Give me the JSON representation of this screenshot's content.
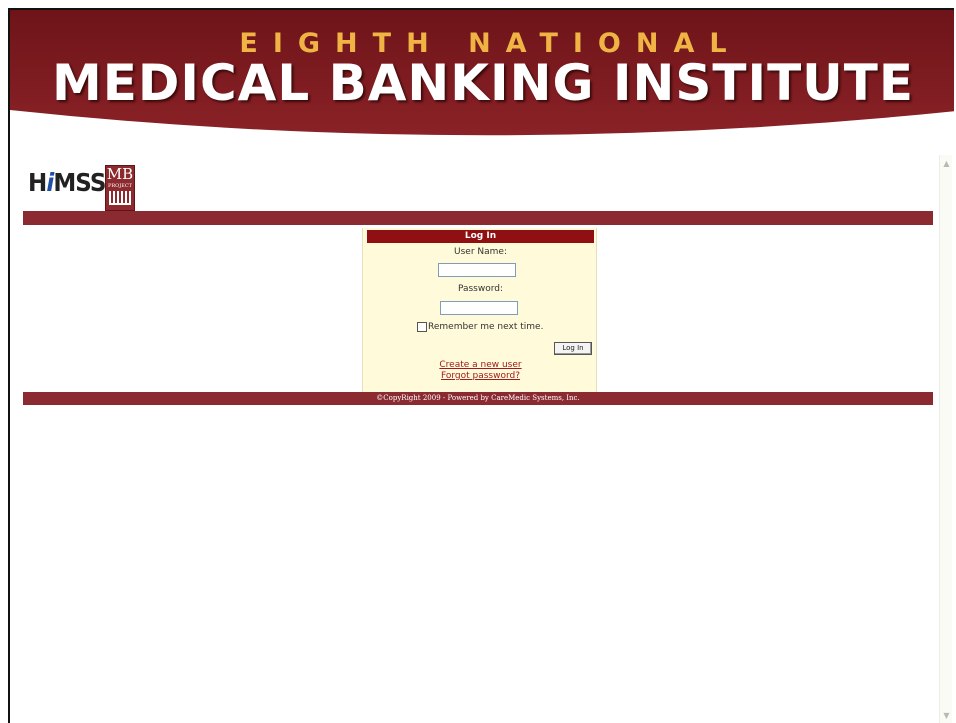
{
  "banner": {
    "line1": "EIGHTH NATIONAL",
    "line2": "MEDICAL BANKING INSTITUTE"
  },
  "logos": {
    "himss": {
      "prefix": "H",
      "accent": "i",
      "suffix": "MSS"
    },
    "mb": {
      "title": "MB",
      "sub": "PROJECT"
    }
  },
  "login": {
    "heading": "Log In",
    "username_label": "User Name:",
    "username_value": "",
    "password_label": "Password:",
    "password_value": "",
    "remember_label": "Remember me next time.",
    "remember_checked": false,
    "submit_label": "Log In",
    "create_link": "Create a new user",
    "forgot_link": "Forgot password?"
  },
  "footer": {
    "copyright": "©CopyRight 2009 - Powered by CareMedic Systems, Inc."
  },
  "colors": {
    "banner": "#7e1a20",
    "bar": "#8b2b31",
    "login_head": "#8f0f12",
    "login_bg": "#fffad9",
    "banner_line1": "#f0b444",
    "link": "#a01b1b"
  },
  "scrollbar": {
    "up_icon": "scroll-up-arrow",
    "down_icon": "scroll-down-arrow"
  }
}
